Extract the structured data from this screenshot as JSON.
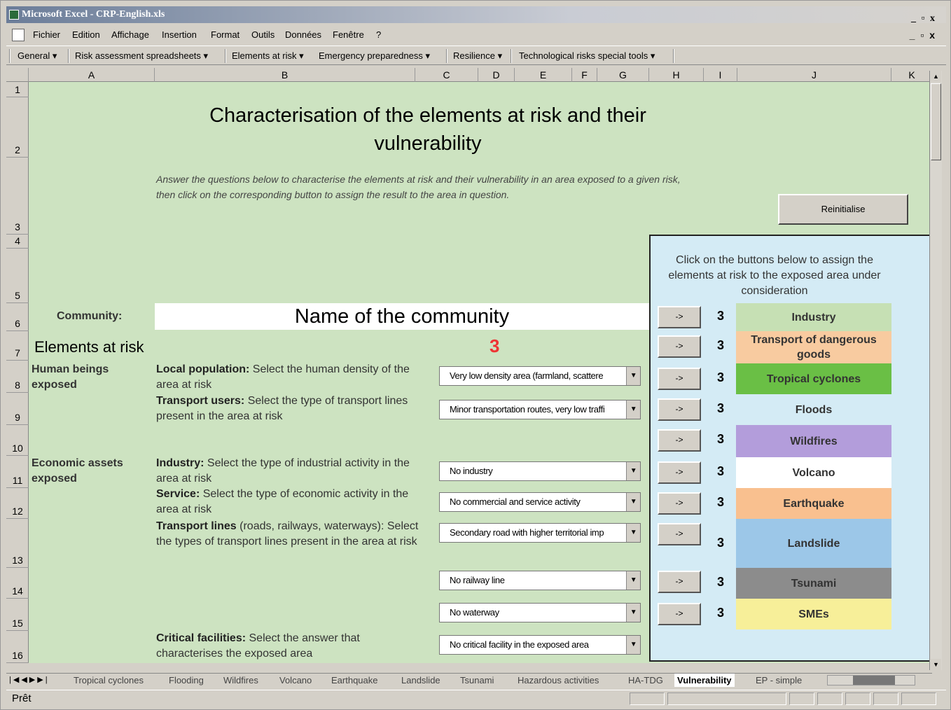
{
  "window": {
    "title": "Microsoft Excel - CRP-English.xls",
    "controls": "_ ▫ x"
  },
  "menu": [
    "Fichier",
    "Edition",
    "Affichage",
    "Insertion",
    "Format",
    "Outils",
    "Données",
    "Fenêtre",
    "?"
  ],
  "toolbar": [
    "General ▾",
    "Risk assessment spreadsheets ▾",
    "Elements at risk ▾",
    "Emergency preparedness ▾",
    "Resilience ▾",
    "Technological risks special tools ▾"
  ],
  "columns": [
    "A",
    "B",
    "C",
    "D",
    "E",
    "F",
    "G",
    "H",
    "I",
    "J",
    "K"
  ],
  "rows": [
    "1",
    "2",
    "3",
    "4",
    "5",
    "6",
    "7",
    "8",
    "9",
    "10",
    "11",
    "12",
    "13",
    "14",
    "15",
    "16"
  ],
  "sheet": {
    "title": "Characterisation of the elements at risk and their vulnerability",
    "instructions": "Answer the questions below to characterise the elements at risk and their vulnerability in an area exposed to a given risk, then click on the corresponding button to assign the result to the area in question.",
    "reinit_label": "Reinitialise",
    "community_label": "Community:",
    "community_name": "Name of the community",
    "elements_heading": "Elements at risk",
    "total": "3",
    "sections": {
      "human": "Human beings exposed",
      "economic": "Economic assets exposed"
    },
    "questions": {
      "local_pop_bold": "Local population:",
      "local_pop": " Select the human density of the area at risk",
      "transport_users_bold": "Transport users:",
      "transport_users": " Select the type of transport lines present in the area at risk",
      "industry_bold": "Industry:",
      "industry": " Select the type of industrial activity in the area at risk",
      "service_bold": "Service:",
      "service": " Select the type of economic activity in the area at risk",
      "transport_lines_bold": "Transport lines",
      "transport_lines": " (roads, railways, waterways): Select the types of transport lines present in the area at risk",
      "critical_bold": "Critical facilities:",
      "critical": " Select the answer that characterises the exposed area"
    },
    "dropdowns": [
      "Very low density area (farmland, scattere",
      "Minor transportation routes, very low traffi",
      "No industry",
      "No commercial and service activity",
      "Secondary road with higher territorial imp",
      "No railway line",
      "No waterway",
      "No critical facility in the exposed area"
    ]
  },
  "panel": {
    "text": "Click on the buttons below to assign the elements at risk to the exposed area under consideration",
    "arrow": "->",
    "risks": [
      {
        "name": "Industry",
        "count": "3",
        "color": "#c6e0b4"
      },
      {
        "name": "Transport of dangerous goods",
        "count": "3",
        "color": "#f8cba0"
      },
      {
        "name": "Tropical cyclones",
        "count": "3",
        "color": "#6abf45"
      },
      {
        "name": "Floods",
        "count": "3",
        "color": "#d4ebf5"
      },
      {
        "name": "Wildfires",
        "count": "3",
        "color": "#b39ddb"
      },
      {
        "name": "Volcano",
        "count": "3",
        "color": "#ffffff"
      },
      {
        "name": "Earthquake",
        "count": "3",
        "color": "#f9c08f"
      },
      {
        "name": "Landslide",
        "count": "3",
        "color": "#9cc7e8"
      },
      {
        "name": "Tsunami",
        "count": "3",
        "color": "#8c8c8c"
      },
      {
        "name": "SMEs",
        "count": "3",
        "color": "#f7ef99"
      }
    ]
  },
  "sheet_tabs": [
    "Tropical cyclones",
    "Flooding",
    "Wildfires",
    "Volcano",
    "Earthquake",
    "Landslide",
    "Tsunami",
    "Hazardous activities",
    "HA-TDG",
    "Vulnerability",
    "EP - simple"
  ],
  "active_tab": "Vulnerability",
  "status": "Prêt"
}
